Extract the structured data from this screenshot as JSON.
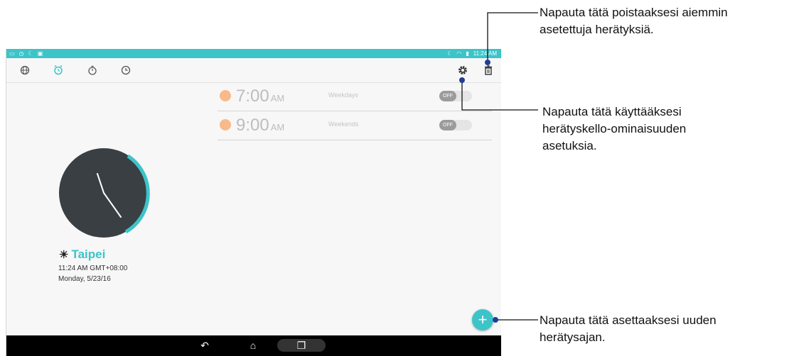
{
  "statusbar": {
    "left_icons": [
      "notification-icon",
      "sync-icon",
      "moon-icon",
      "screenshot-icon"
    ],
    "time": "11:24 AM"
  },
  "toolbar": {
    "tabs": [
      "world-clock-tab",
      "alarm-tab",
      "stopwatch-tab",
      "timer-tab"
    ],
    "active_tab": "alarm-tab",
    "actions": [
      "settings-icon",
      "delete-icon"
    ]
  },
  "alarms": [
    {
      "time": "7:00",
      "ampm": "AM",
      "repeat": "Weekdays",
      "toggle": "OFF"
    },
    {
      "time": "9:00",
      "ampm": "AM",
      "repeat": "Weekends",
      "toggle": "OFF"
    }
  ],
  "world_clock": {
    "city": "Taipei",
    "time_zone_line": "11:24 AM   GMT+08:00",
    "date": "Monday, 5/23/16"
  },
  "callouts": {
    "delete": [
      "Napauta tätä poistaaksesi aiemmin",
      "asetettuja herätyksiä."
    ],
    "settings": [
      "Napauta tätä käyttääksesi",
      "herätyskello-ominaisuuden",
      "asetuksia."
    ],
    "add": [
      "Napauta tätä asettaaksesi uuden",
      "herätysajan."
    ]
  },
  "colors": {
    "accent": "#3cc4c9",
    "clock_face": "#3a3f44",
    "alarm_sun": "#f9b98a"
  }
}
